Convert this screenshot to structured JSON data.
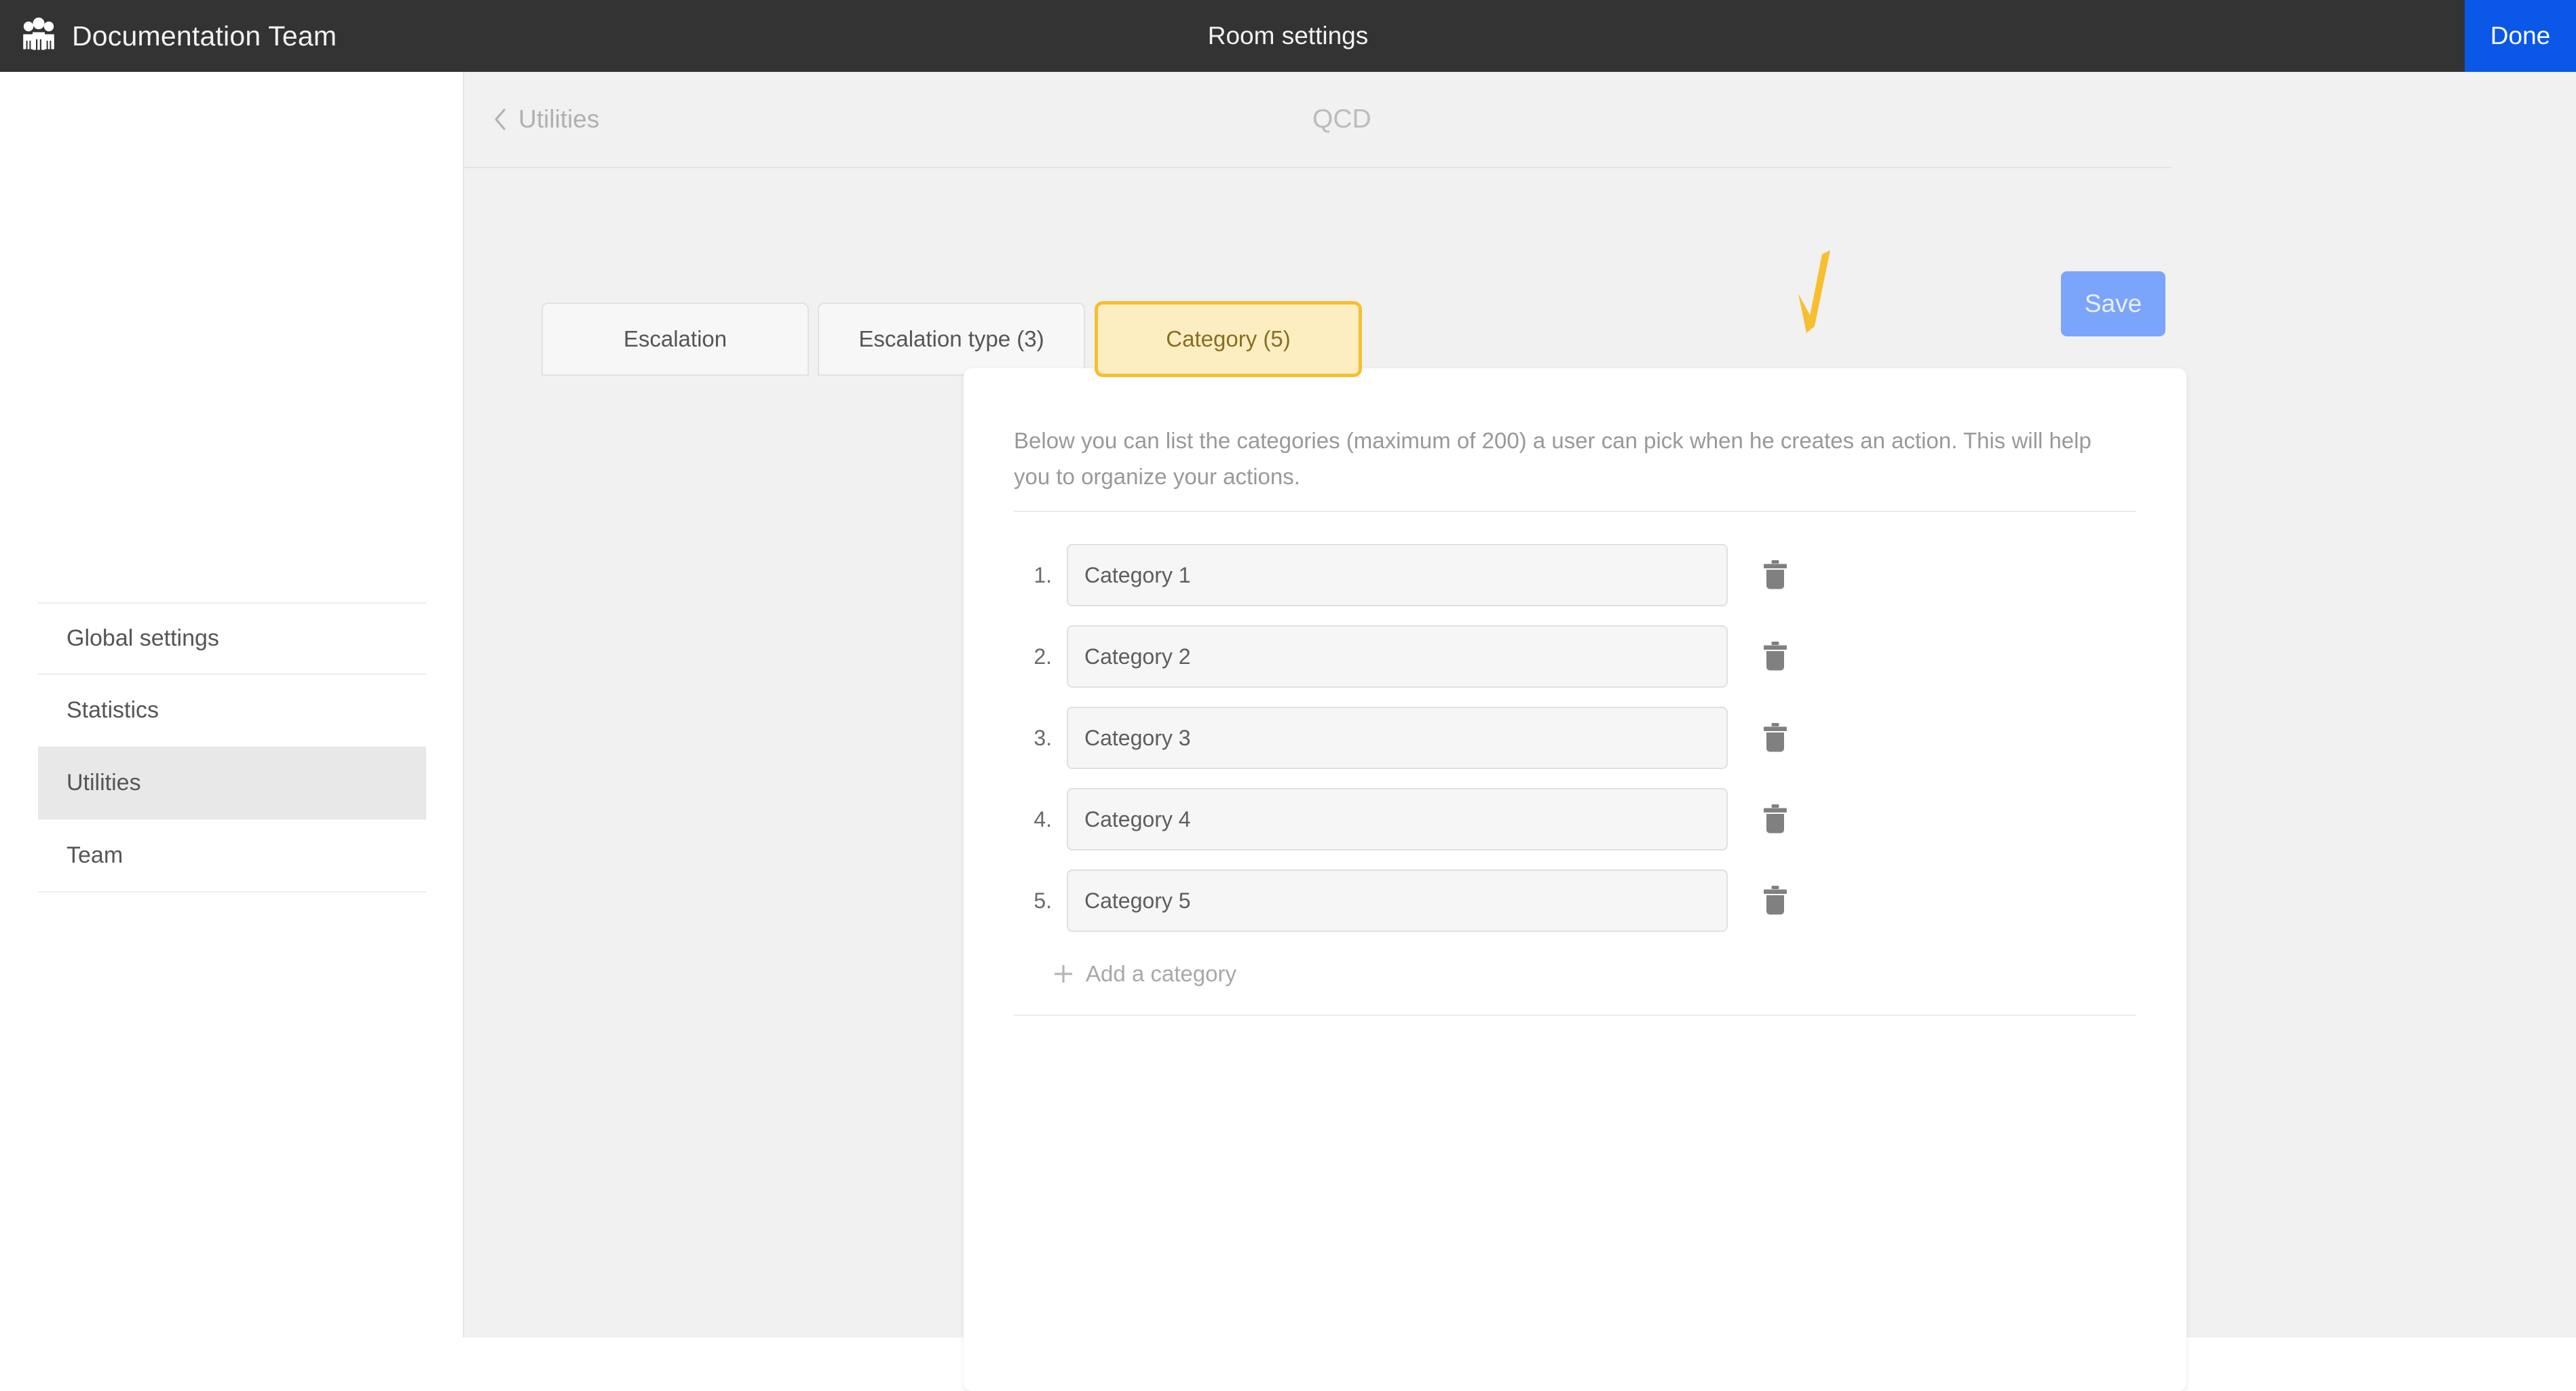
{
  "topbar": {
    "team_icon": "group-people-icon",
    "app_title": "Documentation Team",
    "window_title": "Room settings",
    "done_label": "Done",
    "background_color": "#333333",
    "done_color": "#0b57e8"
  },
  "sidebar": {
    "items": [
      {
        "label": "Global settings",
        "active": false
      },
      {
        "label": "Statistics",
        "active": false
      },
      {
        "label": "Utilities",
        "active": true
      },
      {
        "label": "Team",
        "active": false
      }
    ]
  },
  "content_header": {
    "back_icon": "chevron-left-icon",
    "breadcrumb_label": "Utilities",
    "room_name": "QCD"
  },
  "tabs": [
    {
      "label": "Escalation",
      "selected": false
    },
    {
      "label": "Escalation type (3)",
      "selected": false
    },
    {
      "label": "Category (5)",
      "selected": true
    }
  ],
  "toolbar": {
    "save_label": "Save",
    "save_enabled": false,
    "save_color": "#7ba4fb"
  },
  "annotation": {
    "type": "arrow",
    "color": "#f7bf2f",
    "points_to": "Category (5)"
  },
  "card": {
    "description": "Below you can list the categories (maximum of 200) a user can pick when he creates an action. This will help you to organize your actions.",
    "categories": [
      {
        "index": "1.",
        "value": "Category 1",
        "delete_icon": "trash-icon"
      },
      {
        "index": "2.",
        "value": "Category 2",
        "delete_icon": "trash-icon"
      },
      {
        "index": "3.",
        "value": "Category 3",
        "delete_icon": "trash-icon"
      },
      {
        "index": "4.",
        "value": "Category 4",
        "delete_icon": "trash-icon"
      },
      {
        "index": "5.",
        "value": "Category 5",
        "delete_icon": "trash-icon"
      }
    ],
    "add_icon": "plus-icon",
    "add_label": "Add a category"
  }
}
